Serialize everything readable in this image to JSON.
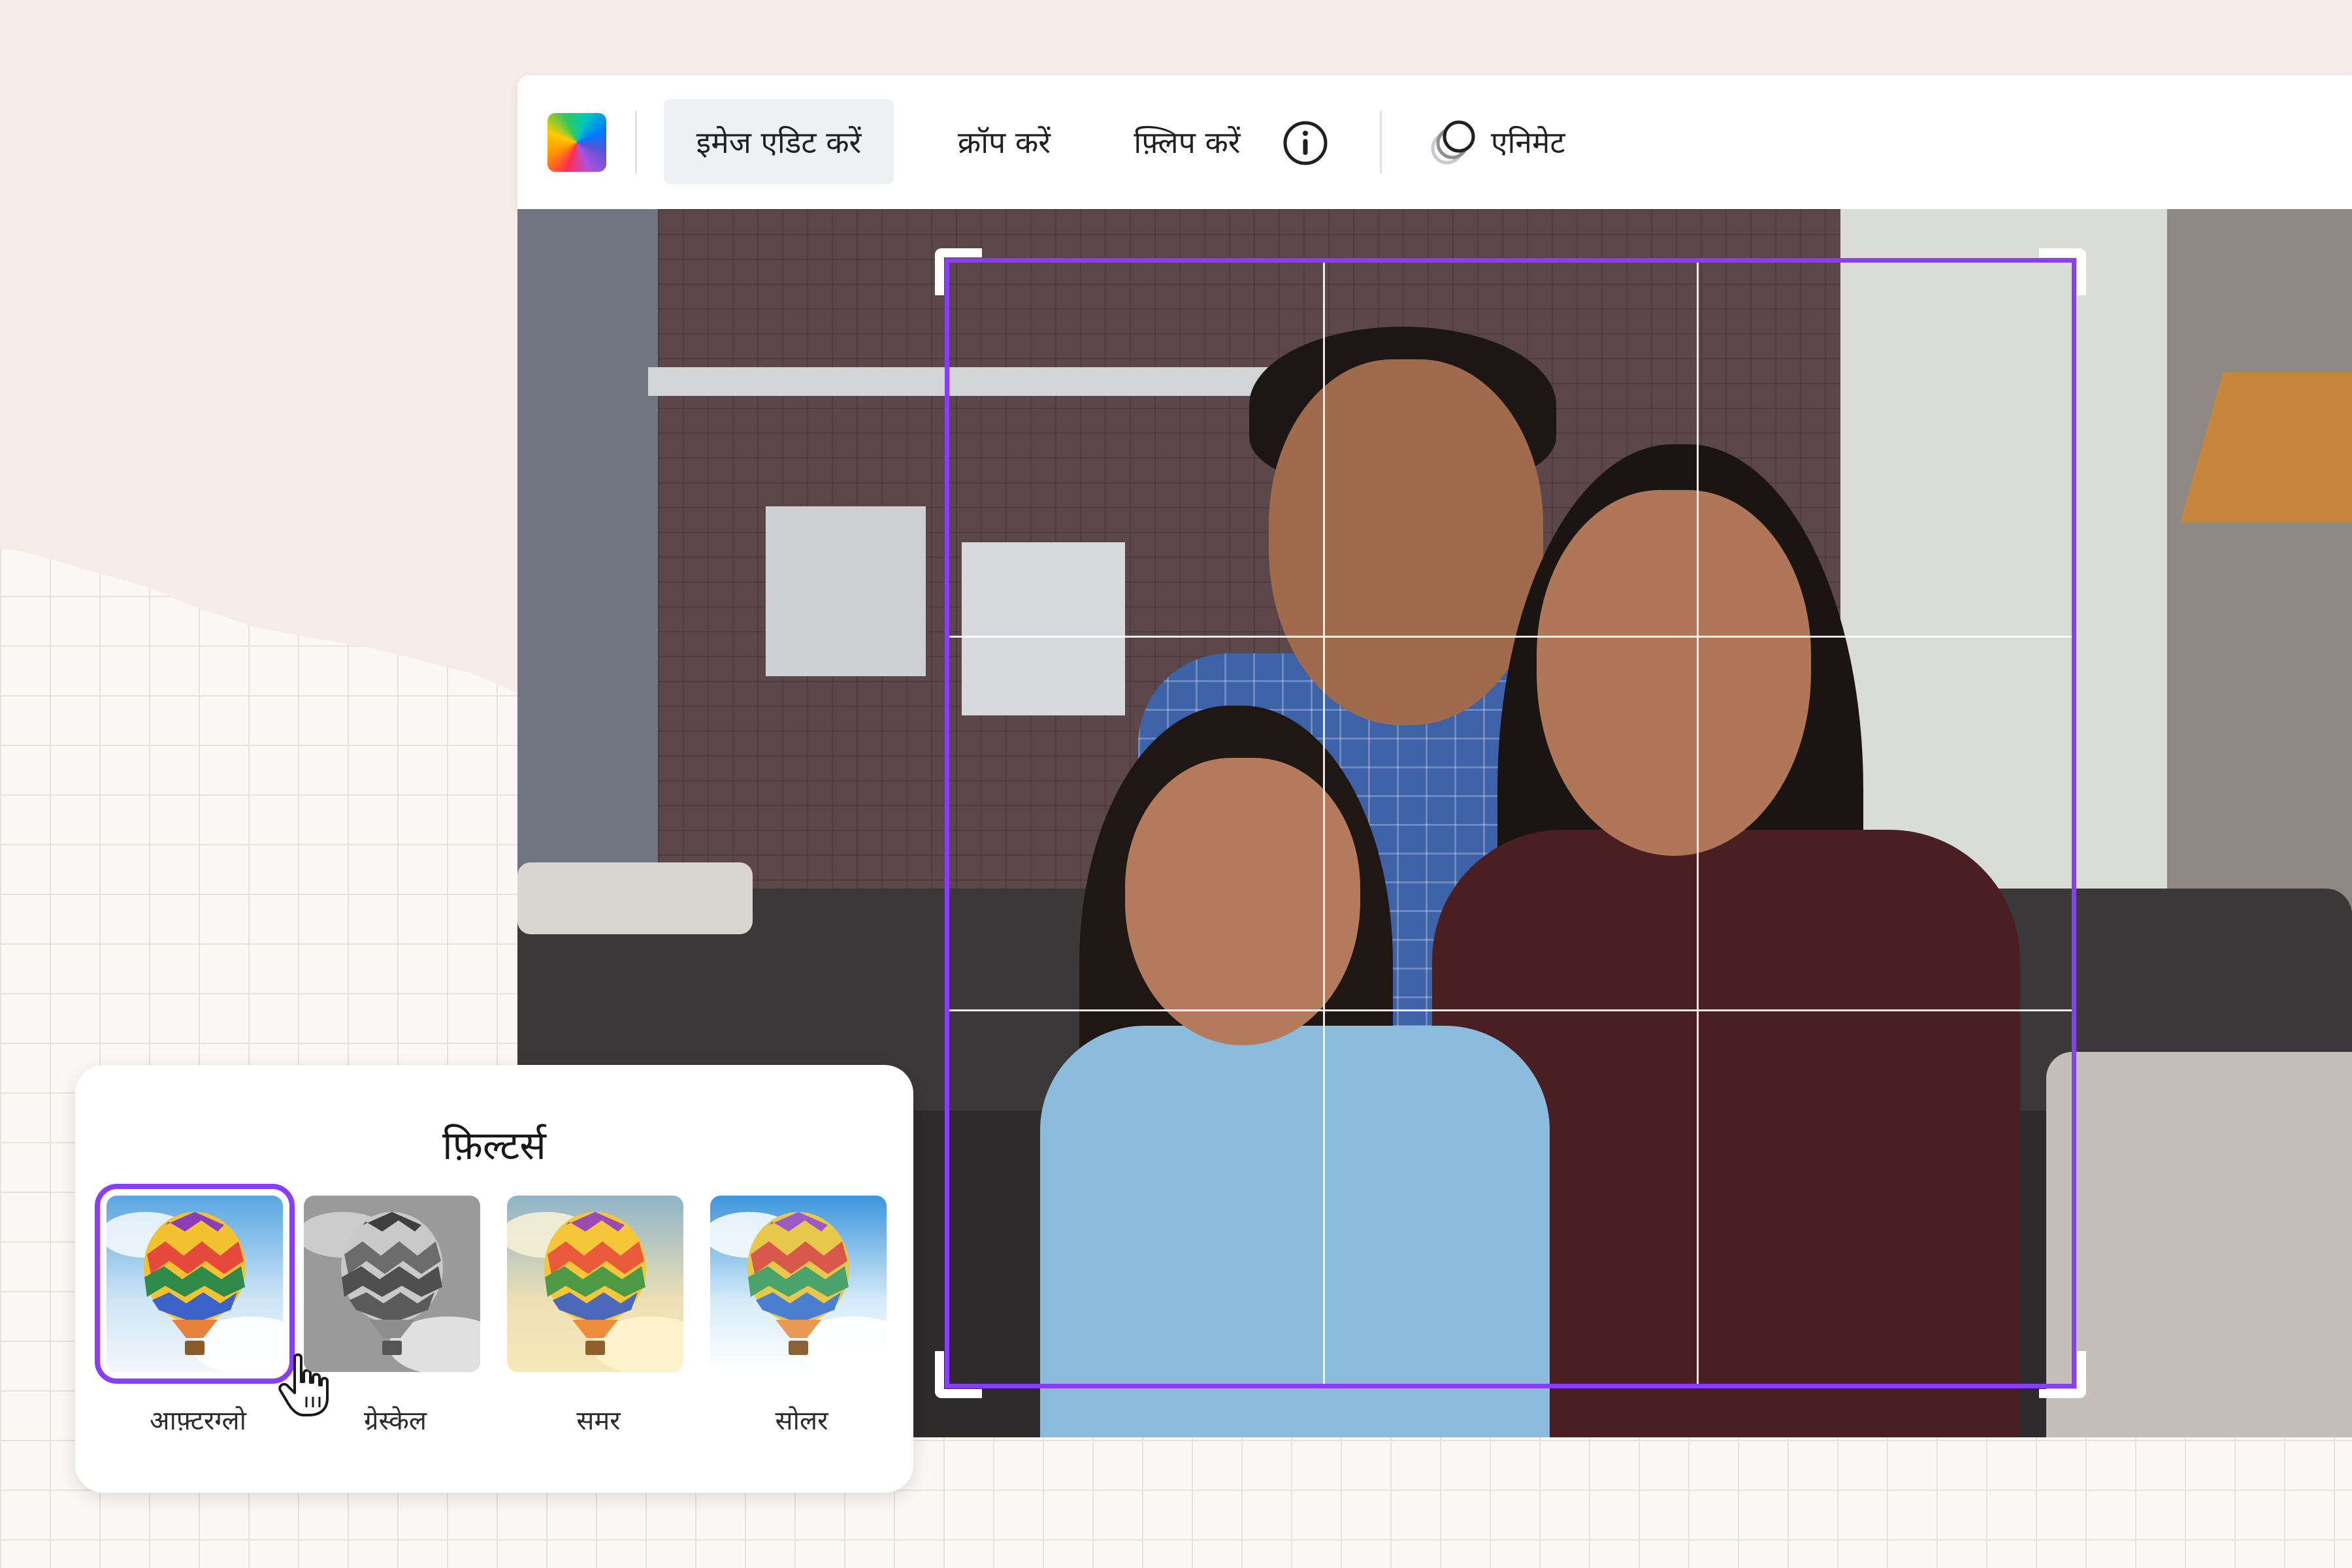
{
  "toolbar": {
    "edit_image": "इमेज एडिट करें",
    "crop": "क्रॉप करें",
    "flip": "फ़्लिप करें",
    "animate": "एनिमेट",
    "icons": [
      "color-palette-icon",
      "info-icon",
      "animate-icon"
    ]
  },
  "filters": {
    "title": "फ़िल्टर्स",
    "items": [
      {
        "label": "आफ़्टरग्लो",
        "selected": true
      },
      {
        "label": "ग्रेस्केल",
        "selected": false
      },
      {
        "label": "समर",
        "selected": false
      },
      {
        "label": "सोलर",
        "selected": false
      }
    ]
  },
  "colors": {
    "accent": "#8b3dff",
    "toolbar_bg": "#ffffff",
    "active_button_bg": "#eff0f3"
  }
}
